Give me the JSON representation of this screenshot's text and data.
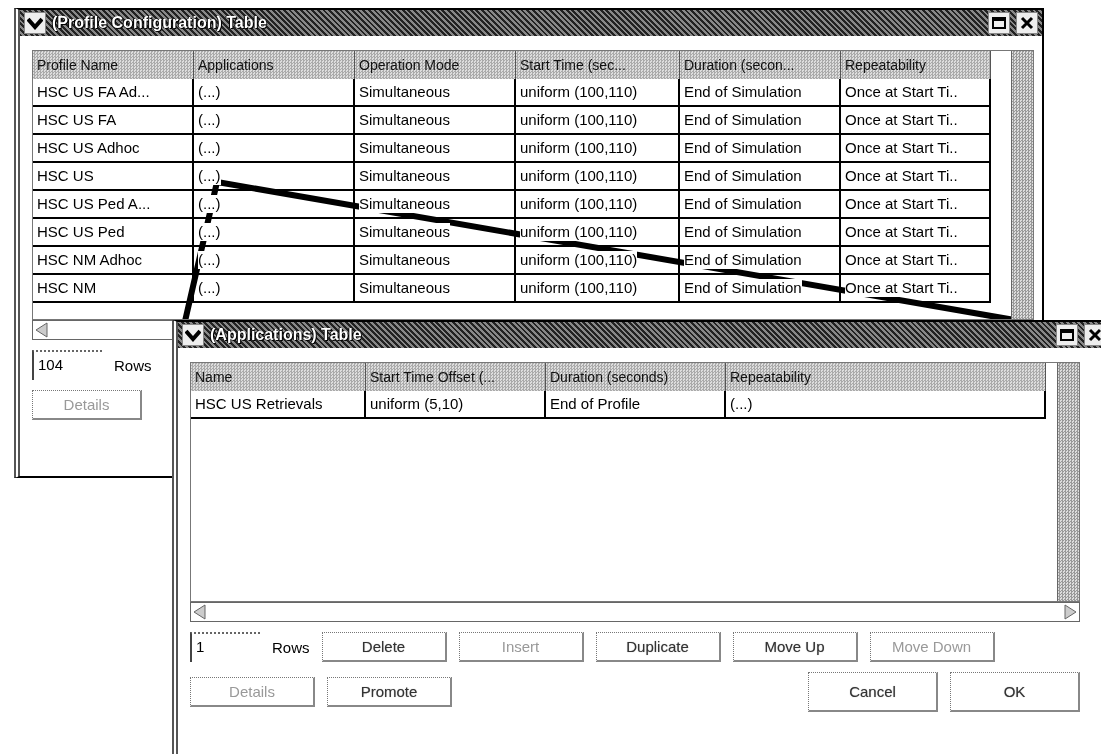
{
  "profile_window": {
    "title": "(Profile Configuration) Table",
    "columns": [
      "Profile Name",
      "Applications",
      "Operation Mode",
      "Start Time (sec...",
      "Duration (secon...",
      "Repeatability"
    ],
    "rows": [
      [
        "HSC US FA Ad...",
        "(...)",
        "Simultaneous",
        "uniform (100,110)",
        "End of Simulation",
        "Once at Start Ti.."
      ],
      [
        "HSC US FA",
        "(...)",
        "Simultaneous",
        "uniform (100,110)",
        "End of Simulation",
        "Once at Start Ti.."
      ],
      [
        "HSC US Adhoc",
        "(...)",
        "Simultaneous",
        "uniform (100,110)",
        "End of Simulation",
        "Once at Start Ti.."
      ],
      [
        "HSC US",
        "(...)",
        "Simultaneous",
        "uniform (100,110)",
        "End of Simulation",
        "Once at Start Ti.."
      ],
      [
        "HSC US Ped A...",
        "(...)",
        "Simultaneous",
        "uniform (100,110)",
        "End of Simulation",
        "Once at Start Ti.."
      ],
      [
        "HSC US Ped",
        "(...)",
        "Simultaneous",
        "uniform (100,110)",
        "End of Simulation",
        "Once at Start Ti.."
      ],
      [
        "HSC NM Adhoc",
        "(...)",
        "Simultaneous",
        "uniform (100,110)",
        "End of Simulation",
        "Once at Start Ti.."
      ],
      [
        "HSC NM",
        "(...)",
        "Simultaneous",
        "uniform (100,110)",
        "End of Simulation",
        "Once at Start Ti.."
      ]
    ],
    "row_count": "104",
    "rows_label": "Rows",
    "buttons": [
      {
        "label": "Details",
        "disabled": true
      }
    ]
  },
  "applications_window": {
    "title": "(Applications) Table",
    "columns": [
      "Name",
      "Start Time Offset (...",
      "Duration (seconds)",
      "Repeatability"
    ],
    "rows": [
      [
        "HSC US Retrievals",
        "uniform (5,10)",
        "End of Profile",
        "(...)"
      ]
    ],
    "row_count": "1",
    "rows_label": "Rows",
    "buttons": [
      {
        "label": "Delete",
        "disabled": false
      },
      {
        "label": "Insert",
        "disabled": true
      },
      {
        "label": "Duplicate",
        "disabled": false
      },
      {
        "label": "Move Up",
        "disabled": false
      },
      {
        "label": "Move Down",
        "disabled": true
      }
    ],
    "bottom_buttons": [
      {
        "label": "Details",
        "disabled": true
      },
      {
        "label": "Promote",
        "disabled": false
      }
    ],
    "dialog_buttons": [
      {
        "label": "Cancel",
        "disabled": false
      },
      {
        "label": "OK",
        "disabled": false
      }
    ]
  }
}
